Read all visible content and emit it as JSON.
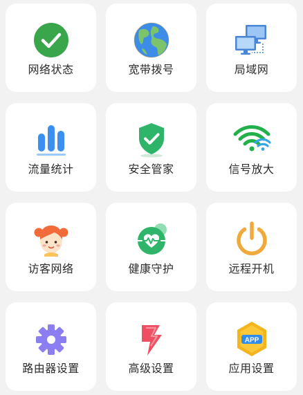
{
  "tiles": [
    {
      "label": "网络状态",
      "icon": "check-circle-icon"
    },
    {
      "label": "宽带拨号",
      "icon": "globe-icon"
    },
    {
      "label": "局域网",
      "icon": "computers-icon"
    },
    {
      "label": "流量统计",
      "icon": "bar-chart-icon"
    },
    {
      "label": "安全管家",
      "icon": "shield-check-icon"
    },
    {
      "label": "信号放大",
      "icon": "wifi-signal-icon"
    },
    {
      "label": "访客网络",
      "icon": "girl-face-icon"
    },
    {
      "label": "健康守护",
      "icon": "heart-pulse-icon"
    },
    {
      "label": "远程开机",
      "icon": "power-icon"
    },
    {
      "label": "路由器设置",
      "icon": "gear-icon"
    },
    {
      "label": "高级设置",
      "icon": "lightning-icon"
    },
    {
      "label": "应用设置",
      "icon": "app-badge-icon"
    }
  ],
  "app_badge_text": "APP",
  "colors": {
    "background": "#f2f2f2",
    "tile": "#ffffff",
    "green": "#3daa4e",
    "blue": "#3c8ff0",
    "orange": "#f2a93b",
    "purple": "#8a7cf0",
    "red": "#ef5366"
  }
}
